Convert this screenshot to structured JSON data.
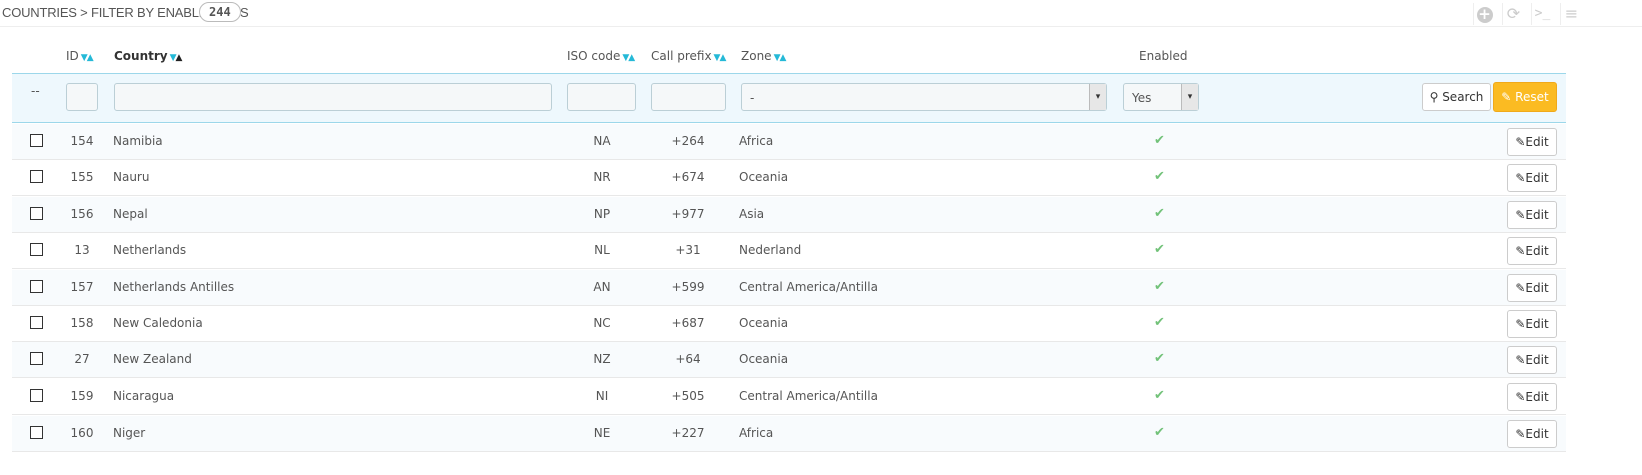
{
  "header": {
    "title": "COUNTRIES > FILTER BY ENABLED: YES",
    "count": "244"
  },
  "toolbar": {
    "add_icon": "plus-circle",
    "refresh_icon": "refresh",
    "sql_icon": ">_",
    "more_icon": "more"
  },
  "columns": {
    "id": "ID",
    "country": "Country",
    "iso": "ISO code",
    "prefix": "Call prefix",
    "zone": "Zone",
    "enabled": "Enabled"
  },
  "filters": {
    "dash": "--",
    "zone_value": "-",
    "enabled_value": "Yes",
    "search_label": "Search",
    "reset_label": "Reset"
  },
  "rows": [
    {
      "id": "154",
      "country": "Namibia",
      "iso": "NA",
      "prefix": "+264",
      "zone": "Africa"
    },
    {
      "id": "155",
      "country": "Nauru",
      "iso": "NR",
      "prefix": "+674",
      "zone": "Oceania"
    },
    {
      "id": "156",
      "country": "Nepal",
      "iso": "NP",
      "prefix": "+977",
      "zone": "Asia"
    },
    {
      "id": "13",
      "country": "Netherlands",
      "iso": "NL",
      "prefix": "+31",
      "zone": "Nederland"
    },
    {
      "id": "157",
      "country": "Netherlands Antilles",
      "iso": "AN",
      "prefix": "+599",
      "zone": "Central America/Antilla"
    },
    {
      "id": "158",
      "country": "New Caledonia",
      "iso": "NC",
      "prefix": "+687",
      "zone": "Oceania"
    },
    {
      "id": "27",
      "country": "New Zealand",
      "iso": "NZ",
      "prefix": "+64",
      "zone": "Oceania"
    },
    {
      "id": "159",
      "country": "Nicaragua",
      "iso": "NI",
      "prefix": "+505",
      "zone": "Central America/Antilla"
    },
    {
      "id": "160",
      "country": "Niger",
      "iso": "NE",
      "prefix": "+227",
      "zone": "Africa"
    }
  ],
  "edit_label": "Edit",
  "colors": {
    "accent": "#25b9d7",
    "reset_bg": "#fbbb22",
    "check": "#72c279"
  }
}
